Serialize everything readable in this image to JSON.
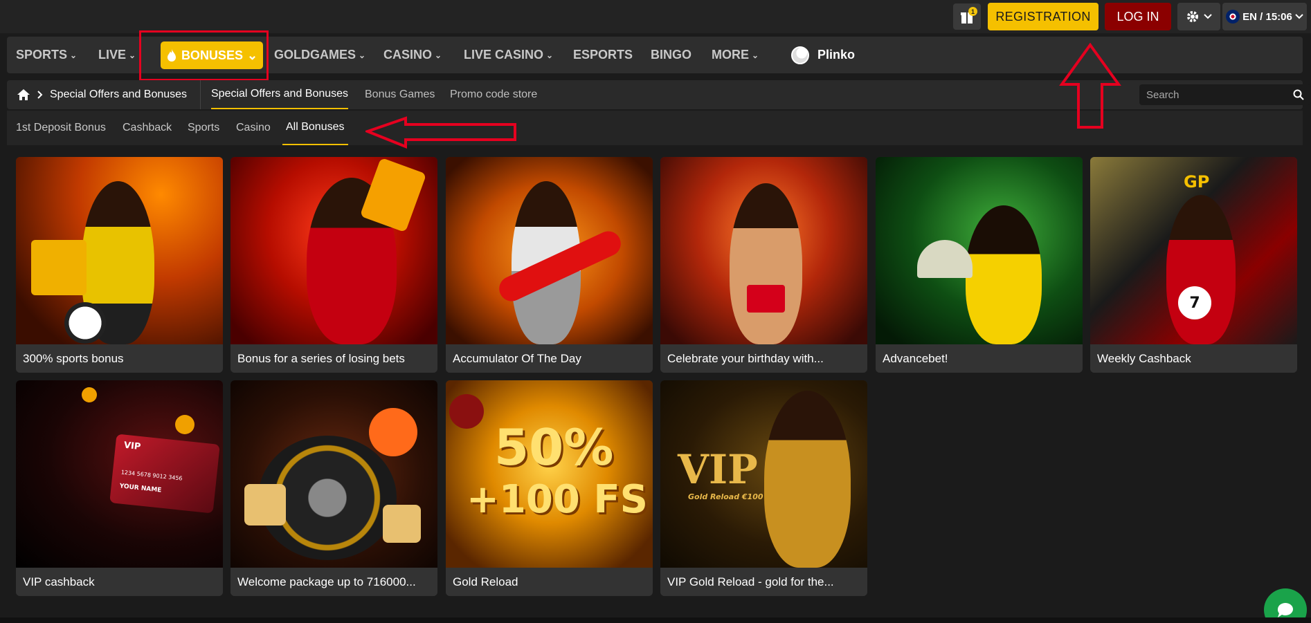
{
  "topbar": {
    "gift_count": "1",
    "registration": "REGISTRATION",
    "login": "LOG IN",
    "lang_time": "EN / 15:06"
  },
  "nav": {
    "sports": "SPORTS",
    "live": "LIVE",
    "bonuses": "BONUSES",
    "goldgames": "GOLDGAMES",
    "casino": "CASINO",
    "live_casino": "LIVE CASINO",
    "esports": "ESPORTS",
    "bingo": "BINGO",
    "more": "MORE",
    "plinko": "Plinko"
  },
  "subnav": {
    "breadcrumb": "Special Offers and Bonuses",
    "tabs": [
      "Special Offers and Bonuses",
      "Bonus Games",
      "Promo code store"
    ],
    "search_placeholder": "Search"
  },
  "filters": [
    "1st Deposit Bonus",
    "Cashback",
    "Sports",
    "Casino",
    "All Bonuses"
  ],
  "cards": [
    "300% sports bonus",
    "Bonus for a series of losing bets",
    "Accumulator Of The Day",
    "Celebrate your birthday with...",
    "Advancebet!",
    "Weekly Cashback",
    "VIP cashback",
    "Welcome package up to 716000...",
    "Gold Reload",
    "VIP Gold Reload - gold for the..."
  ],
  "card_texts": {
    "vip_card": "VIP",
    "card_number": "1234 5678 9012 3456",
    "card_name": "YOUR NAME",
    "gold_reload_big": "50%",
    "gold_reload_sub": "+100 FS",
    "vip_gold": "VIP",
    "vip_gold_sub": "Gold Reload €100",
    "calendar_day": "7",
    "gp_logo": "GP"
  },
  "colors": {
    "accent": "#f5c000",
    "login": "#8b0000",
    "annotation": "#e5001f",
    "chat": "#1aa34a"
  }
}
